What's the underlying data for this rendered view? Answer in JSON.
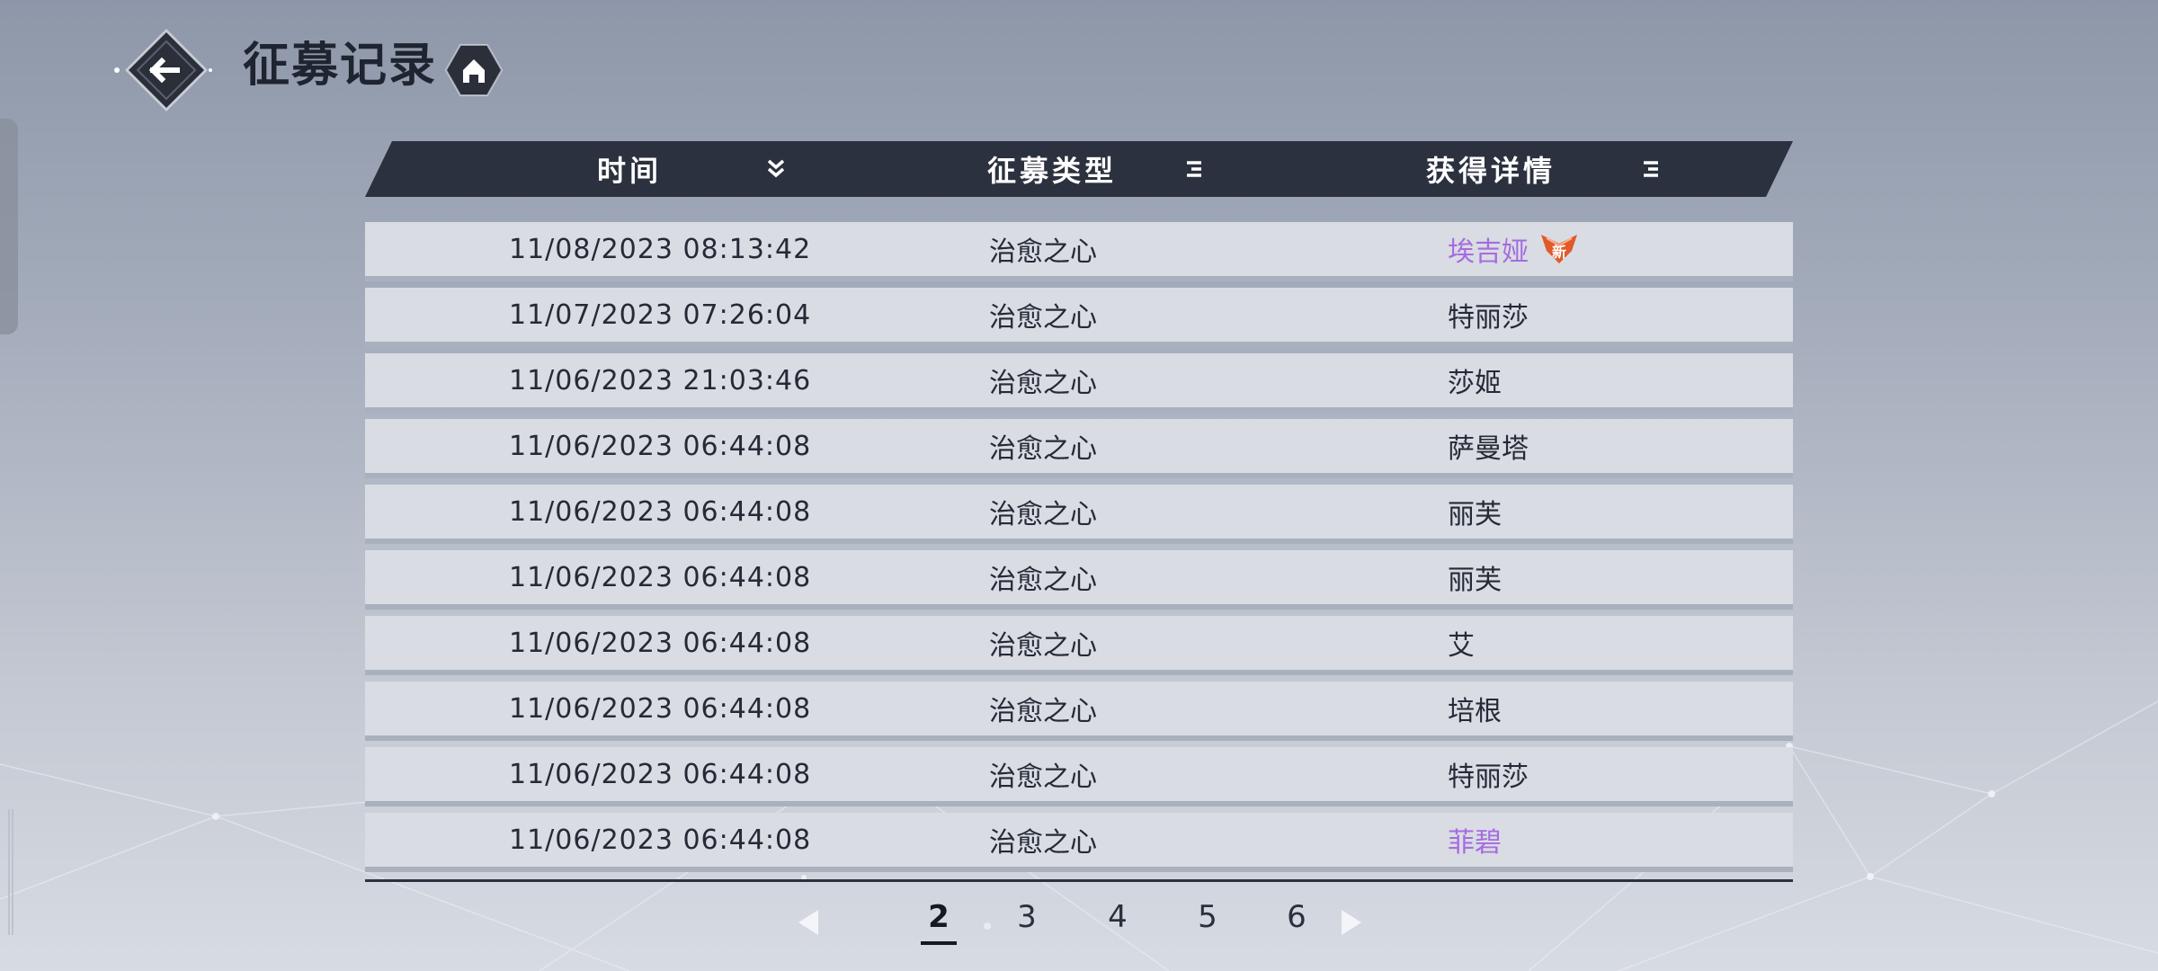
{
  "header": {
    "title": "征募记录",
    "back_icon": "back-arrow-icon",
    "home_icon": "home-icon"
  },
  "table": {
    "columns": [
      {
        "label": "时间",
        "icon": "sort-desc-icon"
      },
      {
        "label": "征募类型",
        "icon": "filter-icon"
      },
      {
        "label": "获得详情",
        "icon": "filter-icon"
      }
    ],
    "rows": [
      {
        "time": "11/08/2023 08:13:42",
        "type": "治愈之心",
        "detail": "埃吉娅",
        "highlight": true,
        "badge": "新"
      },
      {
        "time": "11/07/2023 07:26:04",
        "type": "治愈之心",
        "detail": "特丽莎",
        "highlight": false
      },
      {
        "time": "11/06/2023 21:03:46",
        "type": "治愈之心",
        "detail": "莎姬",
        "highlight": false
      },
      {
        "time": "11/06/2023 06:44:08",
        "type": "治愈之心",
        "detail": "萨曼塔",
        "highlight": false
      },
      {
        "time": "11/06/2023 06:44:08",
        "type": "治愈之心",
        "detail": "丽芙",
        "highlight": false
      },
      {
        "time": "11/06/2023 06:44:08",
        "type": "治愈之心",
        "detail": "丽芙",
        "highlight": false
      },
      {
        "time": "11/06/2023 06:44:08",
        "type": "治愈之心",
        "detail": "艾",
        "highlight": false
      },
      {
        "time": "11/06/2023 06:44:08",
        "type": "治愈之心",
        "detail": "培根",
        "highlight": false
      },
      {
        "time": "11/06/2023 06:44:08",
        "type": "治愈之心",
        "detail": "特丽莎",
        "highlight": false
      },
      {
        "time": "11/06/2023 06:44:08",
        "type": "治愈之心",
        "detail": "菲碧",
        "highlight": true
      }
    ]
  },
  "pagination": {
    "pages": [
      "2",
      "3",
      "4",
      "5",
      "6"
    ],
    "current": "2",
    "prev_icon": "prev-page-icon",
    "next_icon": "next-page-icon"
  },
  "colors": {
    "header_bg": "#2b313e",
    "highlight_text": "#a56ce0",
    "row_bg": "#d9dce3",
    "badge": "#e05a2a"
  }
}
